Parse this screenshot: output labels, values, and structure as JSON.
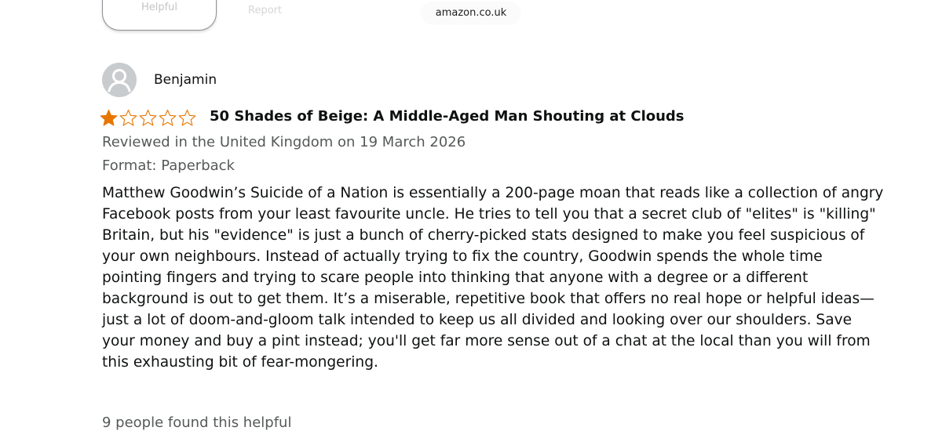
{
  "browser": {
    "url_text": "amazon.co.uk"
  },
  "faded_actions": {
    "helpful_label": "Helpful",
    "report_label": "Report"
  },
  "review": {
    "reviewer_name": "Benjamin",
    "rating": 1,
    "rating_max": 5,
    "star_color": "#e77600",
    "title": "50 Shades of Beige: A Middle-Aged Man Shouting at Clouds",
    "reviewed_in": "Reviewed in the United Kingdom on 19 March 2026",
    "format": "Format: Paperback",
    "body_lines": [
      "Matthew Goodwin’s Suicide of a Nation is essentially a 200-page moan that reads like a collection of angry",
      "Facebook posts from your least favourite uncle. He tries to tell you that a secret club of \"elites\" is \"killing\"",
      "Britain, but his \"evidence\" is just a bunch of cherry-picked stats designed to make you feel suspicious of",
      "your own neighbours. Instead of actually trying to fix the country, Goodwin spends the whole time",
      "pointing fingers and trying to scare people into thinking that anyone with a degree or a different",
      "background is out to get them. It’s a miserable, repetitive book that offers no real hope or helpful ideas—",
      "just a lot of doom-and-gloom talk intended to keep us all divided and looking over our shoulders. Save",
      "your money and buy a pint instead; you'll get far more sense out of a chat at the local than you will from",
      "this exhausting bit of fear-mongering."
    ],
    "helpful_count_text": "9 people found this helpful"
  }
}
